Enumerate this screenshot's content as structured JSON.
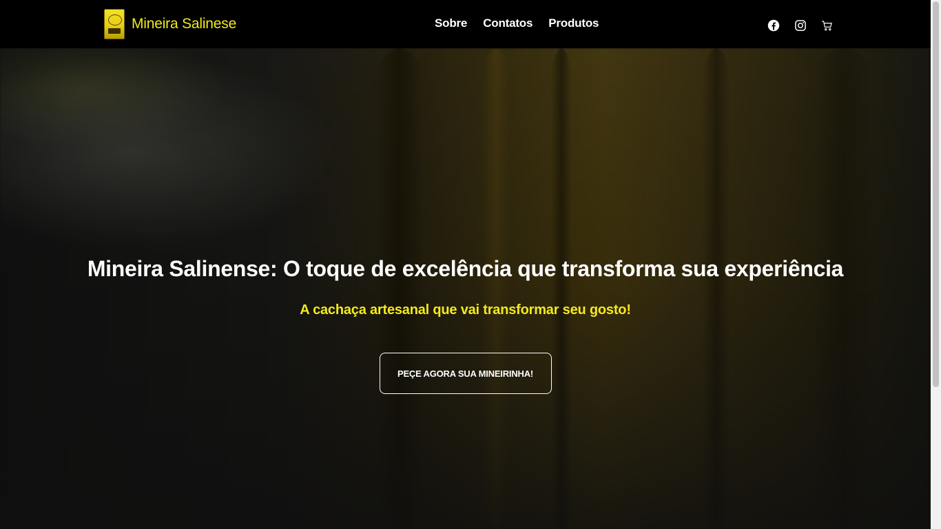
{
  "navbar": {
    "brand_name": "Mineira Salinese",
    "links": [
      {
        "label": "Sobre"
      },
      {
        "label": "Contatos"
      },
      {
        "label": "Produtos"
      }
    ],
    "icons": [
      "facebook-icon",
      "instagram-icon",
      "cart-icon"
    ]
  },
  "hero": {
    "title": "Mineira Salinense: O toque de excelência que transforma sua experiência",
    "subtitle": "A cachaça artesanal que vai transformar seu gosto!",
    "cta_label": "PEÇE AGORA SUA MINEIRINHA!"
  },
  "colors": {
    "accent": "#f3ea1d",
    "navbar_bg": "#000000",
    "text": "#ffffff"
  }
}
